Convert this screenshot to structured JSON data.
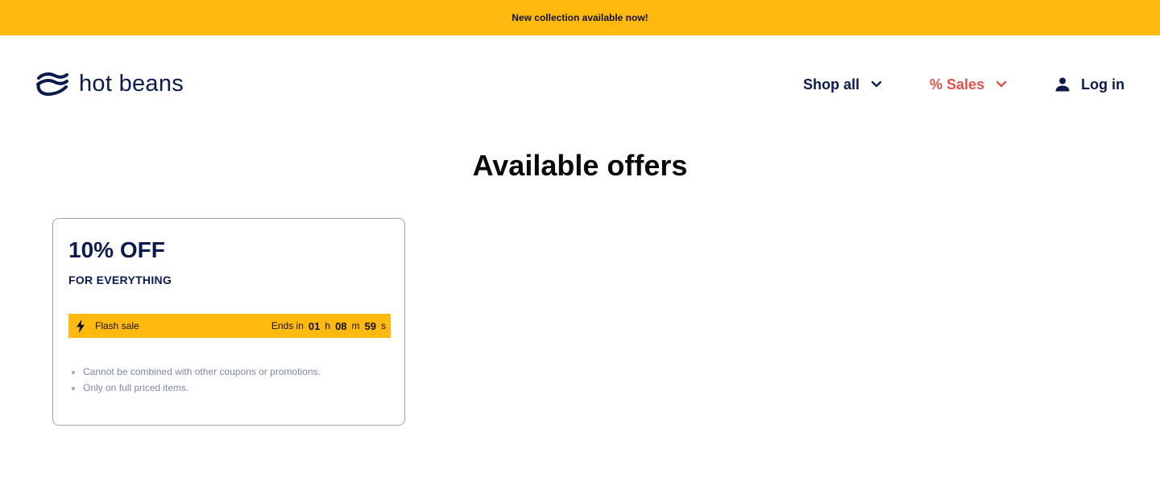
{
  "announcement": {
    "text": "New collection available now!"
  },
  "header": {
    "logo": {
      "text": "hot beans",
      "icon": "waves-logo-icon"
    },
    "nav": {
      "shop_all": "Shop all",
      "sales": "% Sales",
      "login": "Log in"
    },
    "colors": {
      "primary": "#0b1b4d",
      "sales": "#e0534a",
      "accent": "#ffb90f"
    }
  },
  "main": {
    "title": "Available offers",
    "offers": [
      {
        "amount": "10% OFF",
        "scope": "FOR EVERYTHING",
        "flash_label": "Flash sale",
        "countdown": {
          "prefix": "Ends in",
          "hours": "01",
          "hours_unit": "h",
          "minutes": "08",
          "minutes_unit": "m",
          "seconds": "59",
          "seconds_unit": "s"
        },
        "terms": [
          "Cannot be combined with other coupons or promotions.",
          "Only on full priced items."
        ]
      }
    ]
  }
}
